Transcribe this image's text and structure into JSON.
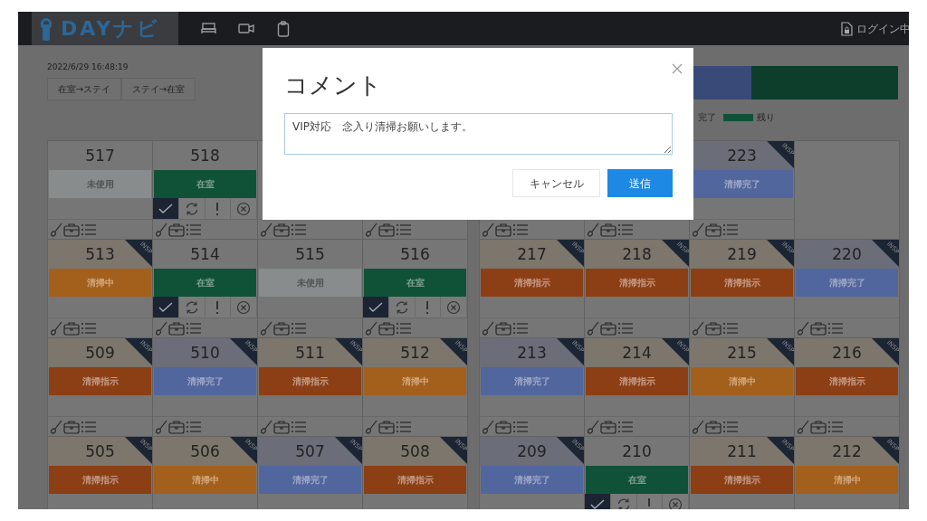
{
  "header": {
    "logo": "DAYナビ",
    "login_status": "ログイン中"
  },
  "timestamp": "2022/6/29 16:48:19",
  "stay_buttons": [
    "在室→ステイ",
    "ステイ→在室"
  ],
  "progress": {
    "level": 0.65,
    "legend": [
      {
        "label": "完了"
      },
      {
        "label": "残り",
        "color": "#0f5238"
      }
    ]
  },
  "blocks": [
    {
      "rows": [
        {
          "cells": [
            {
              "number": "517",
              "status": "未使用",
              "kind": "unused"
            },
            {
              "number": "518",
              "status": "在室",
              "kind": "occupied",
              "checked": true
            },
            {
              "kind": "covered"
            },
            {
              "kind": "covered"
            }
          ]
        },
        {
          "cells": [
            {
              "number": "513",
              "status": "清掃中",
              "kind": "cleaning",
              "badge": "INSP"
            },
            {
              "number": "514",
              "status": "在室",
              "kind": "occupied",
              "checked": true
            },
            {
              "number": "515",
              "status": "未使用",
              "kind": "unused"
            },
            {
              "number": "516",
              "status": "在室",
              "kind": "occupied",
              "checked": true
            }
          ]
        },
        {
          "cells": [
            {
              "number": "509",
              "status": "清掃指示",
              "kind": "instruct",
              "badge": "INSP"
            },
            {
              "number": "510",
              "status": "清掃完了",
              "kind": "complete",
              "badge": "INSP"
            },
            {
              "number": "511",
              "status": "清掃指示",
              "kind": "instruct",
              "badge": "INSP"
            },
            {
              "number": "512",
              "status": "清掃中",
              "kind": "cleaning",
              "badge": "INSP"
            }
          ]
        },
        {
          "cells": [
            {
              "number": "505",
              "status": "清掃指示",
              "kind": "instruct",
              "badge": "INSP"
            },
            {
              "number": "506",
              "status": "清掃中",
              "kind": "cleaning",
              "badge": "INSP"
            },
            {
              "number": "507",
              "status": "清掃完了",
              "kind": "complete",
              "badge": "INSP"
            },
            {
              "number": "508",
              "status": "清掃指示",
              "kind": "instruct",
              "badge": "INSP"
            }
          ]
        }
      ]
    },
    {
      "rows": [
        {
          "cells": [
            {
              "kind": "covered"
            },
            {
              "kind": "covered"
            },
            {
              "number": "223",
              "status": "清掃完了",
              "kind": "complete",
              "badge": "INSP"
            },
            {
              "kind": "empty"
            }
          ]
        },
        {
          "cells": [
            {
              "number": "217",
              "status": "清掃指示",
              "kind": "instruct",
              "badge": "INSP"
            },
            {
              "number": "218",
              "status": "清掃指示",
              "kind": "instruct",
              "badge": "INSP"
            },
            {
              "number": "219",
              "status": "清掃指示",
              "kind": "instruct",
              "badge": "INSP"
            },
            {
              "number": "220",
              "status": "清掃完了",
              "kind": "complete",
              "badge": "INSP"
            }
          ]
        },
        {
          "cells": [
            {
              "number": "213",
              "status": "清掃完了",
              "kind": "complete",
              "badge": "INSP"
            },
            {
              "number": "214",
              "status": "清掃指示",
              "kind": "instruct",
              "badge": "INSP"
            },
            {
              "number": "215",
              "status": "清掃中",
              "kind": "cleaning",
              "badge": "INSP"
            },
            {
              "number": "216",
              "status": "清掃指示",
              "kind": "instruct",
              "badge": "INSP"
            }
          ]
        },
        {
          "cells": [
            {
              "number": "209",
              "status": "清掃完了",
              "kind": "complete",
              "badge": "INSP"
            },
            {
              "number": "210",
              "status": "在室",
              "kind": "occupied",
              "checked": true
            },
            {
              "number": "211",
              "status": "清掃指示",
              "kind": "instruct",
              "badge": "INSP"
            },
            {
              "number": "212",
              "status": "清掃中",
              "kind": "cleaning",
              "badge": "INSP"
            }
          ]
        }
      ]
    }
  ],
  "modal": {
    "title": "コメント",
    "comment": "VIP対応　念入り清掃お願いします。",
    "buttons": [
      {
        "label": "キャンセル",
        "kind": "secondary"
      },
      {
        "label": "送信",
        "kind": "primary"
      }
    ]
  }
}
